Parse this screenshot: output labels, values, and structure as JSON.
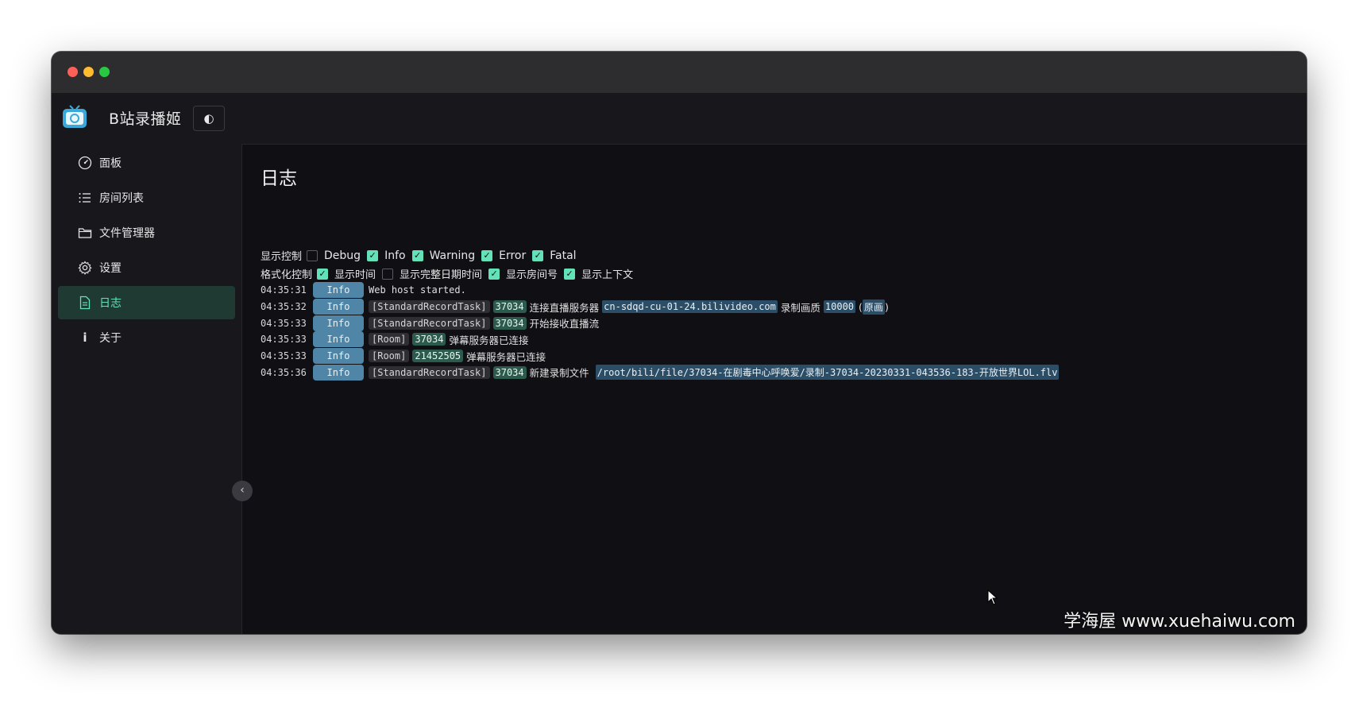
{
  "app": {
    "title": "B站录播姬",
    "theme_toggle": "◐"
  },
  "sidebar": {
    "items": [
      {
        "label": "面板",
        "icon": "dashboard-icon"
      },
      {
        "label": "房间列表",
        "icon": "list-icon"
      },
      {
        "label": "文件管理器",
        "icon": "folder-icon"
      },
      {
        "label": "设置",
        "icon": "gear-icon"
      },
      {
        "label": "日志",
        "icon": "document-icon",
        "active": true
      },
      {
        "label": "关于",
        "icon": "info-icon"
      }
    ],
    "collapse": "‹"
  },
  "page": {
    "title": "日志"
  },
  "display_control": {
    "label": "显示控制",
    "options": [
      {
        "label": "Debug",
        "checked": false
      },
      {
        "label": "Info",
        "checked": true
      },
      {
        "label": "Warning",
        "checked": true
      },
      {
        "label": "Error",
        "checked": true
      },
      {
        "label": "Fatal",
        "checked": true
      }
    ]
  },
  "format_control": {
    "label": "格式化控制",
    "options": [
      {
        "label": "显示时间",
        "checked": true
      },
      {
        "label": "显示完整日期时间",
        "checked": false
      },
      {
        "label": "显示房间号",
        "checked": true
      },
      {
        "label": "显示上下文",
        "checked": true
      }
    ]
  },
  "logs": [
    {
      "time": "04:35:31",
      "level": "Info",
      "text": "Web host started."
    },
    {
      "time": "04:35:32",
      "level": "Info",
      "tag": "[StandardRecordTask]",
      "room": "37034",
      "msg": "连接直播服务器",
      "host": "cn-sdqd-cu-01-24.bilivideo.com",
      "msg2": "录制画质",
      "quality": "10000",
      "quality_name": "原画"
    },
    {
      "time": "04:35:33",
      "level": "Info",
      "tag": "[StandardRecordTask]",
      "room": "37034",
      "msg": "开始接收直播流"
    },
    {
      "time": "04:35:33",
      "level": "Info",
      "tag": "[Room]",
      "room": "37034",
      "msg": "弹幕服务器已连接"
    },
    {
      "time": "04:35:33",
      "level": "Info",
      "tag": "[Room]",
      "room": "21452505",
      "msg": "弹幕服务器已连接"
    },
    {
      "time": "04:35:36",
      "level": "Info",
      "tag": "[StandardRecordTask]",
      "room": "37034",
      "msg": "新建录制文件",
      "path": "/root/bili/file/37034-在剧毒中心呼唤爱/录制-37034-20230331-043536-183-开放世界LOL.flv"
    }
  ],
  "watermark": "学海屋 www.xuehaiwu.com"
}
